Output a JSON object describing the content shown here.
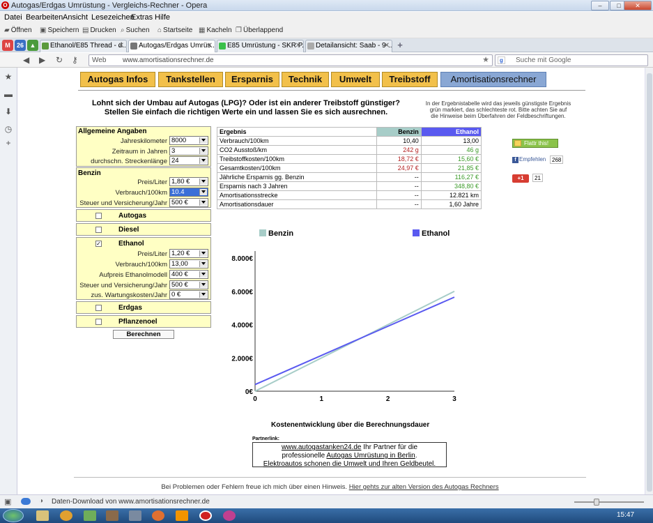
{
  "window": {
    "title": "Autogas/Erdgas Umrüstung - Vergleichs-Rechner - Opera"
  },
  "menu": [
    "Datei",
    "Bearbeiten",
    "Ansicht",
    "Lesezeichen",
    "Extras",
    "Hilfe"
  ],
  "toolbar": [
    "Öffnen",
    "Speichern",
    "Drucken",
    "Suchen",
    "Startseite",
    "Kacheln",
    "Überlappend"
  ],
  "tabs": [
    {
      "label": "Ethanol/E85 Thread - d..."
    },
    {
      "label": "Autogas/Erdgas Umrüs..."
    },
    {
      "label": "E85 Umrüstung - SKR P..."
    },
    {
      "label": "Detailansicht: Saab - 9-..."
    }
  ],
  "address": {
    "web_label": "Web",
    "url": "www.amortisationsrechner.de",
    "search_placeholder": "Suche mit Google"
  },
  "nav": [
    "Autogas Infos",
    "Tankstellen",
    "Ersparnis",
    "Technik",
    "Umwelt",
    "Treibstoff",
    "Amortisationsrechner"
  ],
  "intro": {
    "line1": "Lohnt sich der Umbau auf Autogas (LPG)? Oder ist ein anderer Treibstoff günstiger?",
    "line2": "Stellen Sie einfach die richtigen Werte ein und lassen Sie es sich ausrechnen.",
    "hint1": "In der Ergebnistabelle wird das jeweils günstigste Ergebnis",
    "hint2": "grün markiert, das schlechteste rot. Bitte achten Sie auf",
    "hint3": "die Hinweise beim Überfahren der Feldbeschriftungen."
  },
  "general": {
    "title": "Allgemeine Angaben",
    "rows": [
      {
        "label": "Jahreskilometer",
        "value": "8000"
      },
      {
        "label": "Zeitraum in Jahren",
        "value": "3"
      },
      {
        "label": "durchschn. Streckenlänge",
        "value": "24"
      }
    ]
  },
  "benzin": {
    "title": "Benzin",
    "rows": [
      {
        "label": "Preis/Liter",
        "value": "1,80 €"
      },
      {
        "label": "Verbrauch/100km",
        "value": "10.4"
      },
      {
        "label": "Steuer und Versicherung/Jahr",
        "value": "500 €"
      }
    ]
  },
  "options": {
    "autogas": "Autogas",
    "diesel": "Diesel",
    "ethanol": "Ethanol",
    "erdgas": "Erdgas",
    "pflanzenoel": "Pflanzenoel",
    "checked_mark": "✓"
  },
  "ethanol": {
    "rows": [
      {
        "label": "Preis/Liter",
        "value": "1,20 €"
      },
      {
        "label": "Verbrauch/100km",
        "value": "13,00"
      },
      {
        "label": "Aufpreis Ethanolmodell",
        "value": "400 €"
      },
      {
        "label": "Steuer und Versicherung/Jahr",
        "value": "500 €"
      },
      {
        "label": "zus. Wartungskosten/Jahr",
        "value": "0 €"
      }
    ]
  },
  "calc_button": "Berechnen",
  "results": {
    "headers": [
      "Ergebnis",
      "Benzin",
      "Ethanol"
    ],
    "header_colors": {
      "benzin": "#a7cdc8",
      "ethanol": "#5a5af0"
    },
    "rows": [
      {
        "label": "Verbrauch/100km",
        "benzin": "10,40",
        "ethanol": "13,00",
        "bc": "",
        "ec": ""
      },
      {
        "label": "CO2 Ausstoß/km",
        "benzin": "242 g",
        "ethanol": "46 g",
        "bc": "red",
        "ec": "grn"
      },
      {
        "label": "Treibstoffkosten/100km",
        "benzin": "18,72 €",
        "ethanol": "15,60 €",
        "bc": "red",
        "ec": "grn"
      },
      {
        "label": "Gesamtkosten/100km",
        "benzin": "24,97 €",
        "ethanol": "21,85 €",
        "bc": "red",
        "ec": "grn"
      },
      {
        "label": "Jährliche Ersparnis gg. Benzin",
        "benzin": "--",
        "ethanol": "116,27 €",
        "bc": "",
        "ec": "grn"
      },
      {
        "label": "Ersparnis nach 3 Jahren",
        "benzin": "--",
        "ethanol": "348,80 €",
        "bc": "",
        "ec": "grn"
      },
      {
        "label": "Amortisationsstrecke",
        "benzin": "--",
        "ethanol": "12.821 km",
        "bc": "",
        "ec": ""
      },
      {
        "label": "Amortisationsdauer",
        "benzin": "--",
        "ethanol": "1,60 Jahre",
        "bc": "",
        "ec": ""
      }
    ]
  },
  "social": {
    "flattr": "Flattr this!",
    "fb": "Empfehlen",
    "fb_count": "268",
    "gplus": "+1",
    "gplus_count": "21"
  },
  "chart_data": {
    "type": "line",
    "x": [
      0,
      1,
      2,
      3
    ],
    "series": [
      {
        "name": "Benzin",
        "color": "#a7cdc8",
        "values": [
          0,
          2000,
          4000,
          6000
        ]
      },
      {
        "name": "Ethanol",
        "color": "#5a5af0",
        "values": [
          400,
          2150,
          3900,
          5650
        ]
      }
    ],
    "yticks": [
      "0€",
      "2.000€",
      "4.000€",
      "6.000€",
      "8.000€"
    ],
    "xticks": [
      "0",
      "1",
      "2",
      "3"
    ],
    "ylim": [
      0,
      8000
    ],
    "xlim": [
      0,
      3
    ],
    "legend": "top",
    "title": "Kostenentwicklung über die Berechnungsdauer"
  },
  "partner": {
    "label": "Partnerlink:",
    "link1": "www.autogastanken24.de",
    "text1": " Ihr Partner für die",
    "text2": "professionelle ",
    "link2": "Autogas Umrüstung in Berlin",
    "text3": ".",
    "link3": "Elektroautos",
    "text4": " schonen die Umwelt und Ihren Geldbeutel."
  },
  "footer": {
    "text": "Bei Problemen oder Fehlern freue ich mich über einen Hinweis. ",
    "link": "Hier gehts zur alten Version des Autogas Rechners"
  },
  "status": {
    "text": "Daten-Download von www.amortisationsrechner.de"
  },
  "clock": "15:47"
}
